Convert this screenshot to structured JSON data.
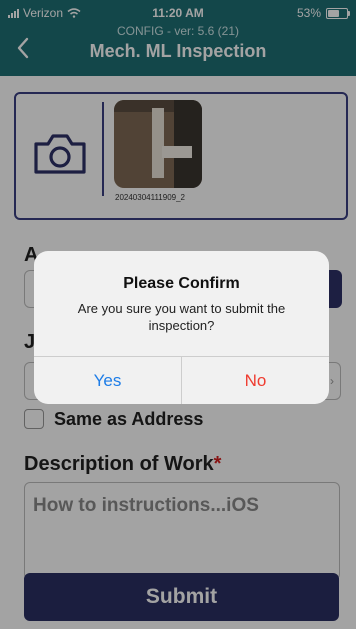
{
  "status_bar": {
    "carrier": "Verizon",
    "time": "11:20 AM",
    "battery": "53%",
    "battery_level": 0.53
  },
  "header": {
    "subtitle": "CONFIG - ver: 5.6 (21)",
    "title": "Mech. ML Inspection",
    "back_icon": "chevron-left-icon"
  },
  "photos": {
    "camera_icon": "camera-icon",
    "items": [
      {
        "caption": "20240304111909_2"
      }
    ]
  },
  "form": {
    "address_label_partial": "A",
    "job_label_partial": "J",
    "same_as_address_label": "Same as Address",
    "description_label": "Description of Work",
    "required_mark": "*",
    "description_placeholder": "How to instructions...iOS",
    "submit_label": "Submit"
  },
  "dialog": {
    "title": "Please Confirm",
    "message": "Are you sure you want to submit the inspection?",
    "yes_label": "Yes",
    "no_label": "No"
  },
  "colors": {
    "header": "#1f6f75",
    "accent": "#2b2f63",
    "yes": "#1e7de7",
    "no": "#ef3c30",
    "required": "#d51f1f"
  }
}
